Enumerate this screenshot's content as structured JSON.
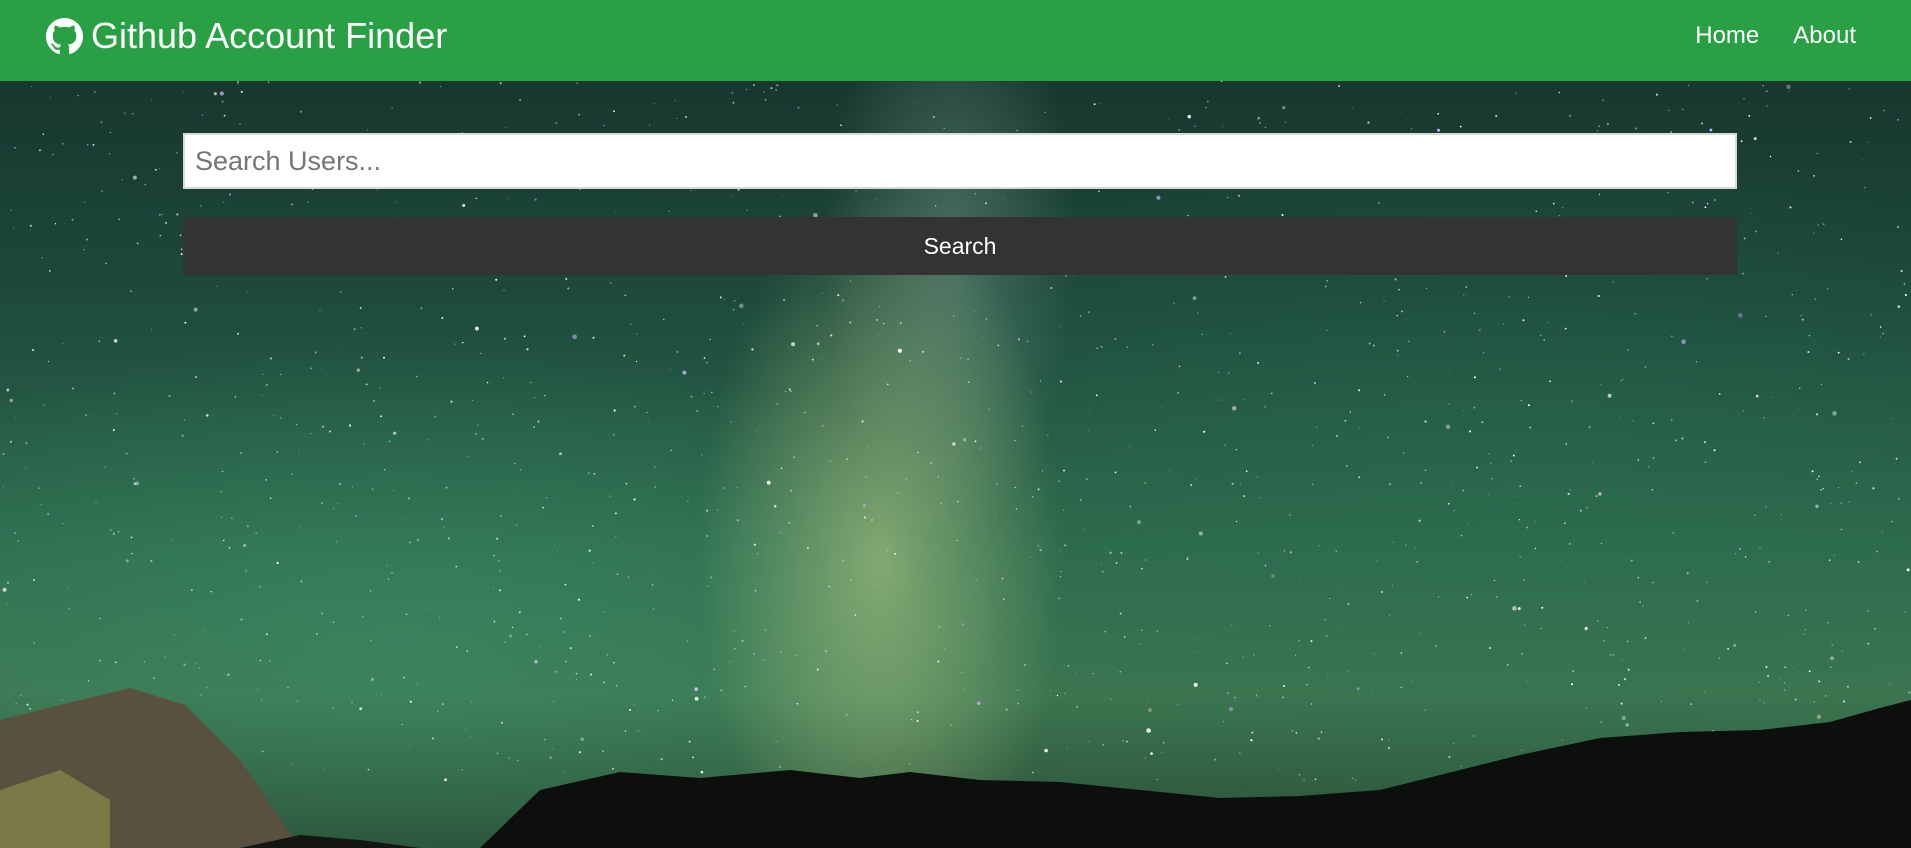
{
  "navbar": {
    "brand_title": "Github Account Finder",
    "brand_icon": "github-icon",
    "links": [
      {
        "label": "Home"
      },
      {
        "label": "About"
      }
    ],
    "background_color": "#28a043"
  },
  "search": {
    "placeholder": "Search Users...",
    "value": "",
    "button_label": "Search",
    "button_color": "#333333"
  },
  "background": {
    "type": "night-sky-milky-way-photo"
  }
}
